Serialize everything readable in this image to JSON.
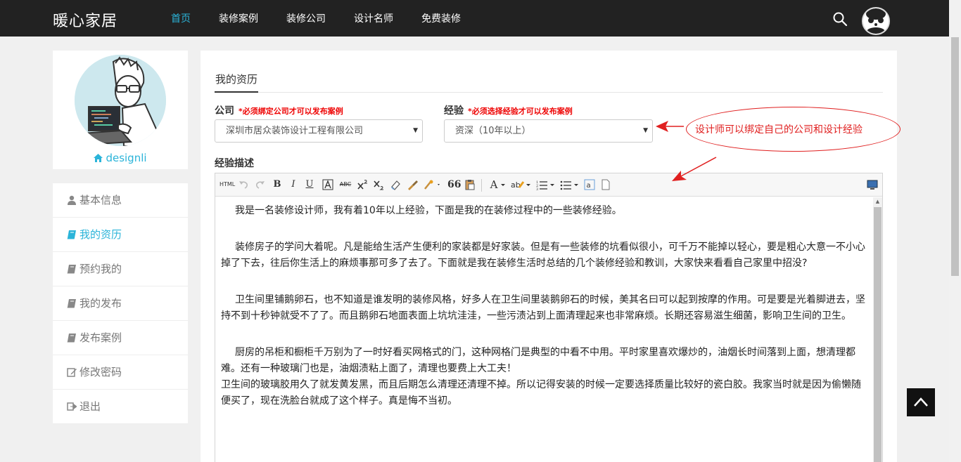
{
  "brand": "暖心家居",
  "nav": [
    {
      "label": "首页",
      "active": true
    },
    {
      "label": "装修案例"
    },
    {
      "label": "装修公司"
    },
    {
      "label": "设计名师"
    },
    {
      "label": "免费装修"
    }
  ],
  "profile": {
    "username": "designli"
  },
  "side_menu": [
    {
      "label": "基本信息",
      "icon": "user-icon"
    },
    {
      "label": "我的资历",
      "icon": "book-icon",
      "active": true
    },
    {
      "label": "预约我的",
      "icon": "book-icon"
    },
    {
      "label": "我的发布",
      "icon": "book-icon"
    },
    {
      "label": "发布案例",
      "icon": "book-icon"
    },
    {
      "label": "修改密码",
      "icon": "edit-icon"
    },
    {
      "label": "退出",
      "icon": "logout-icon"
    }
  ],
  "main": {
    "tab": "我的资历",
    "company": {
      "label": "公司",
      "required_note": "*必须绑定公司才可以发布案例",
      "value": "深圳市居众装饰设计工程有限公司"
    },
    "experience": {
      "label": "经验",
      "required_note": "*必须选择经验才可以发布案例",
      "value": "资深（10年以上）"
    },
    "description_label": "经验描述",
    "toolbar": {
      "html_label": "HTML",
      "bold": "B",
      "italic": "I",
      "underline": "U",
      "abc": "ABC",
      "font_color": "A",
      "quote": "66"
    },
    "editor_paragraphs": [
      {
        "text": "我是一名装修设计师，我有着10年以上经验，下面是我的在装修过程中的一些装修经验。",
        "indent": true
      },
      {
        "text": "装修房子的学问大着呢。凡是能给生活产生便利的家装都是好家装。但是有一些装修的坑看似很小，可千万不能掉以轻心，要是粗心大意一不小心掉了下去，往后你生活上的麻烦事那可多了去了。下面就是我在装修生活时总结的几个装修经验和教训，大家快来看看自己家里中招没?",
        "indent": true
      },
      {
        "text": "卫生间里铺鹅卵石，也不知道是谁发明的装修风格，好多人在卫生间里装鹅卵石的时候，美其名曰可以起到按摩的作用。可是要是光着脚进去，坚持不到十秒钟就受不了了。而且鹅卵石地面表面上坑坑洼洼，一些污渍沾到上面清理起来也非常麻烦。长期还容易滋生细菌，影响卫生间的卫生。",
        "indent": true
      },
      {
        "text": "厨房的吊柜和橱柜千万别为了一时好看买网格式的门，这种网格门是典型的中看不中用。平时家里喜欢爆炒的，油烟长时间落到上面，想清理都难。还有一种玻璃门也是，油烟渍粘上面了，清理也要费上大工夫！",
        "indent": true
      },
      {
        "text": "卫生间的玻璃胶用久了就发黄发黑，而且后期怎么清理还清理不掉。所以记得安装的时候一定要选择质量比较好的瓷白胶。我家当时就是因为偷懒随便买了，现在洗脸台就成了这个样子。真是悔不当初。",
        "indent": false
      }
    ]
  },
  "annotation": {
    "text": "设计师可以绑定自己的公司和设计经验"
  },
  "colors": {
    "accent": "#2bb4d9",
    "topbar": "#222222",
    "required": "#ee0000",
    "annotation": "#e02020"
  }
}
